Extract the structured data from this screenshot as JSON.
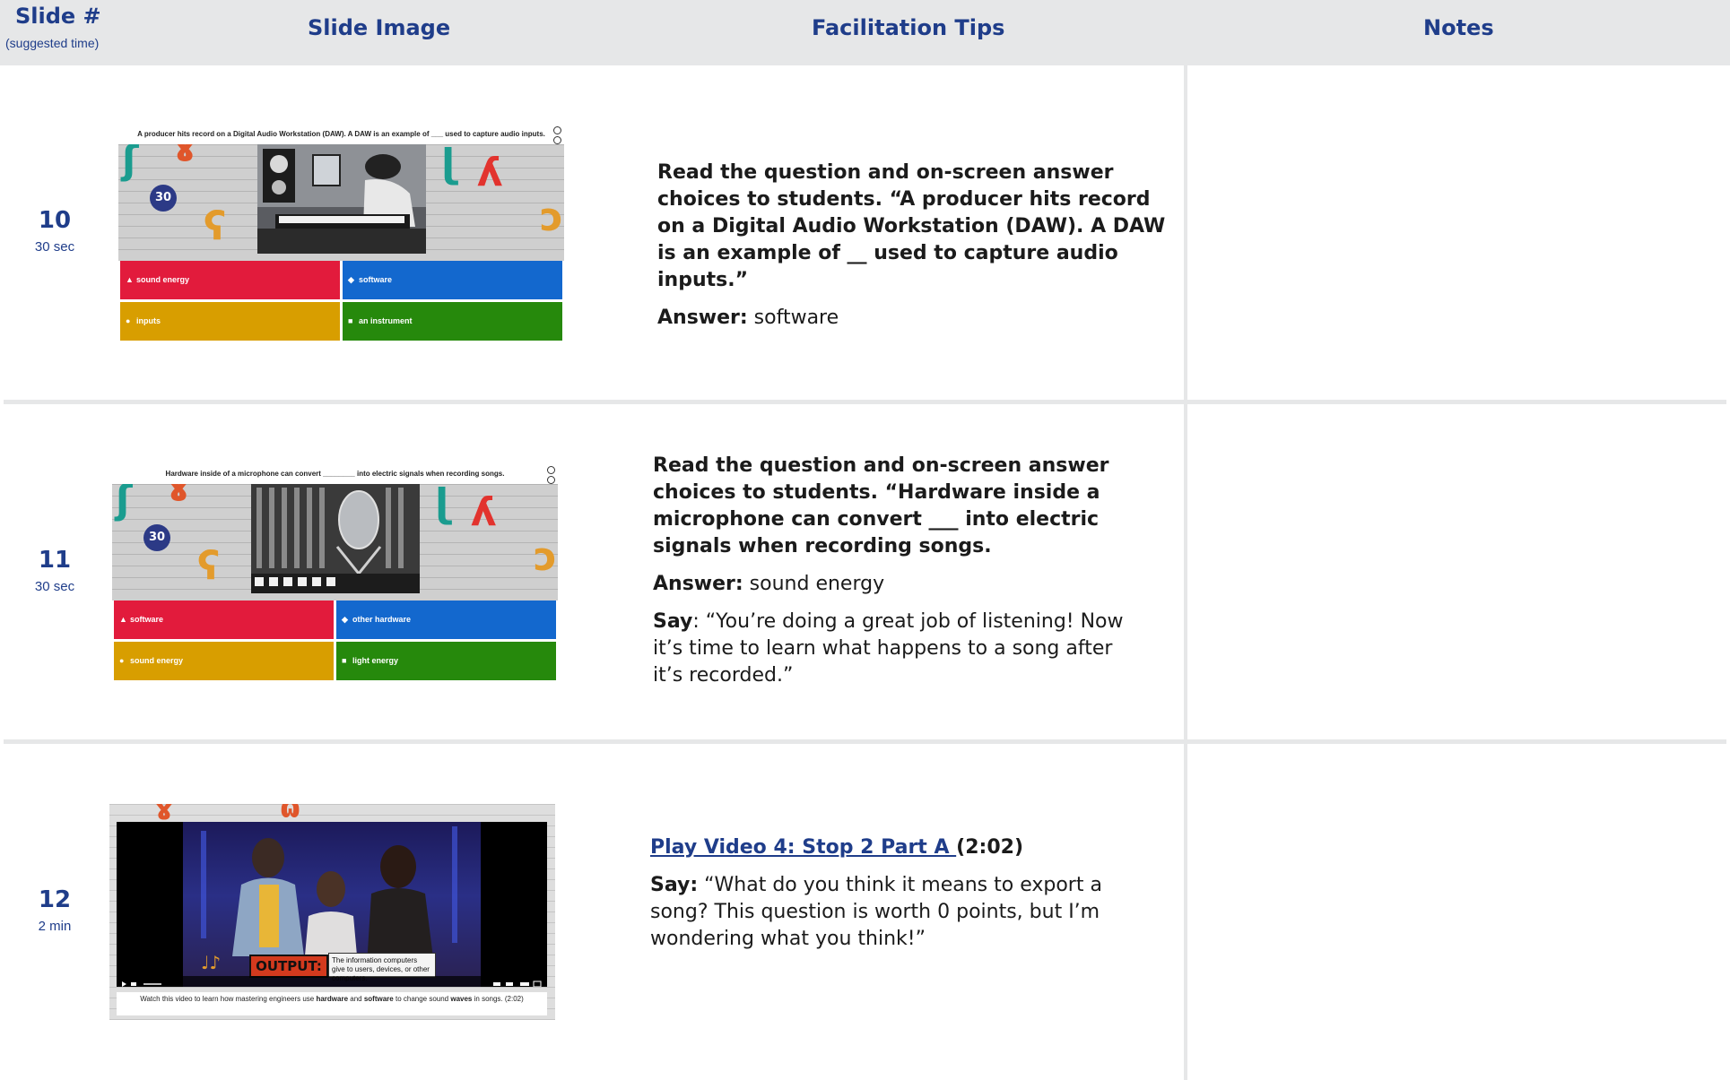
{
  "header": {
    "slide": "Slide #",
    "slide_sub": "(suggested time)",
    "image": "Slide Image",
    "tips": "Facilitation Tips",
    "notes": "Notes"
  },
  "rows": [
    {
      "number": "10",
      "time": "30 sec",
      "slide": {
        "question": "A producer hits record on a Digital Audio Workstation (DAW). A DAW is an example of ___ used to capture audio inputs.",
        "timer": "30",
        "answers": [
          "sound energy",
          "software",
          "inputs",
          "an instrument"
        ]
      },
      "tips": {
        "p1": "Read the question and on-screen answer choices to students. “A producer hits record on a Digital Audio Workstation (DAW). A DAW is an example of __ used to capture audio inputs.”",
        "answer_label": "Answer:",
        "answer_value": " software"
      }
    },
    {
      "number": "11",
      "time": "30 sec",
      "slide": {
        "question": "Hardware inside of a microphone can convert ________ into electric signals when recording songs.",
        "timer": "30",
        "answers": [
          "software",
          "other hardware",
          "sound energy",
          "light energy"
        ]
      },
      "tips": {
        "p1": "Read the question and on-screen answer choices to students. “Hardware inside a microphone can convert ___ into electric signals when recording songs.",
        "answer_label": "Answer:",
        "answer_value": " sound energy",
        "say_label": "Say",
        "say_value": ": “You’re doing a great job of listening! Now it’s time to learn what happens to a song after it’s recorded.”"
      }
    },
    {
      "number": "12",
      "time": "2 min",
      "slide": {
        "output_word": "OUTPUT:",
        "output_def": "The information computers give to users, devices, or other computers.",
        "caption_parts": [
          "Watch this video to learn how mastering engineers use ",
          "hardware",
          " and ",
          "software",
          " to change sound ",
          "waves",
          " in songs. (2:02)"
        ]
      },
      "tips": {
        "link": "Play Video 4: Stop 2 Part A ",
        "duration": "(2:02)",
        "say_label": "Say:",
        "say_value": " “What do you think it means to export a song? This question is worth 0 points, but I’m wondering what you think!”"
      }
    }
  ],
  "colors": {
    "header_bg": "#e6e7e8",
    "brand_blue": "#1f3d8a",
    "answer_red": "#e21b3c",
    "answer_blue": "#1368ce",
    "answer_yellow": "#d89e00",
    "answer_green": "#26890c"
  },
  "icons": {
    "triangle": "triangle-icon",
    "diamond": "diamond-icon",
    "circle": "circle-icon",
    "square": "square-icon"
  }
}
